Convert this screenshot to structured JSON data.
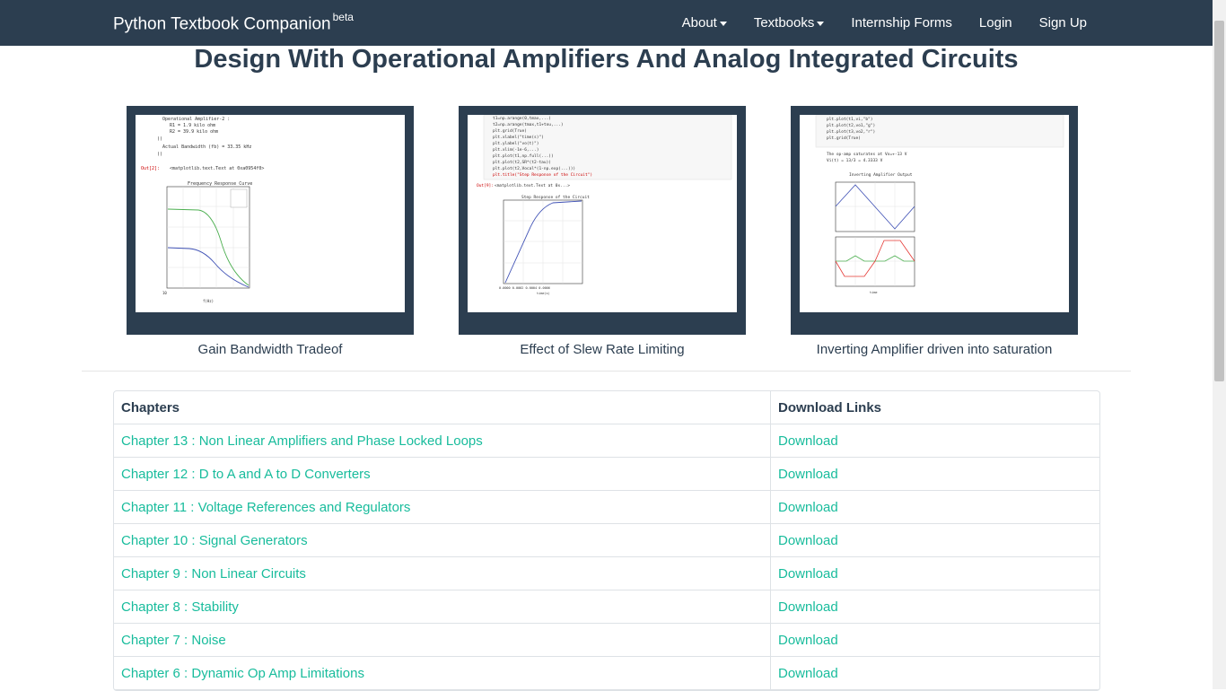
{
  "navbar": {
    "brand": "Python Textbook Companion",
    "brand_badge": "beta",
    "items": [
      {
        "label": "About",
        "dropdown": true
      },
      {
        "label": "Textbooks",
        "dropdown": true
      },
      {
        "label": "Internship Forms",
        "dropdown": false
      },
      {
        "label": "Login",
        "dropdown": false
      },
      {
        "label": "Sign Up",
        "dropdown": false
      }
    ]
  },
  "page_title": "Design With Operational Amplifiers And Analog Integrated Circuits",
  "gallery": [
    {
      "caption": "Gain Bandwidth Tradeof",
      "plot_title": "Frequency Response Curve"
    },
    {
      "caption": "Effect of Slew Rate Limiting",
      "plot_title": "Step Response of the Circuit"
    },
    {
      "caption": "Inverting Amplifier driven into saturation",
      "plot_title": "Inverting Amplifier Output"
    }
  ],
  "table": {
    "headers": [
      "Chapters",
      "Download Links"
    ],
    "rows": [
      {
        "chapter": "Chapter 13 : Non Linear Amplifiers and Phase Locked Loops",
        "link": "Download"
      },
      {
        "chapter": "Chapter 12 : D to A and A to D Converters",
        "link": "Download"
      },
      {
        "chapter": "Chapter 11 : Voltage References and Regulators",
        "link": "Download"
      },
      {
        "chapter": "Chapter 10 : Signal Generators",
        "link": "Download"
      },
      {
        "chapter": "Chapter 9 : Non Linear Circuits",
        "link": "Download"
      },
      {
        "chapter": "Chapter 8 : Stability",
        "link": "Download"
      },
      {
        "chapter": "Chapter 7 : Noise",
        "link": "Download"
      },
      {
        "chapter": "Chapter 6 : Dynamic Op Amp Limitations",
        "link": "Download"
      }
    ]
  },
  "colors": {
    "navbar": "#2c3e50",
    "link": "#18bc9c",
    "text": "#2c3e50"
  }
}
